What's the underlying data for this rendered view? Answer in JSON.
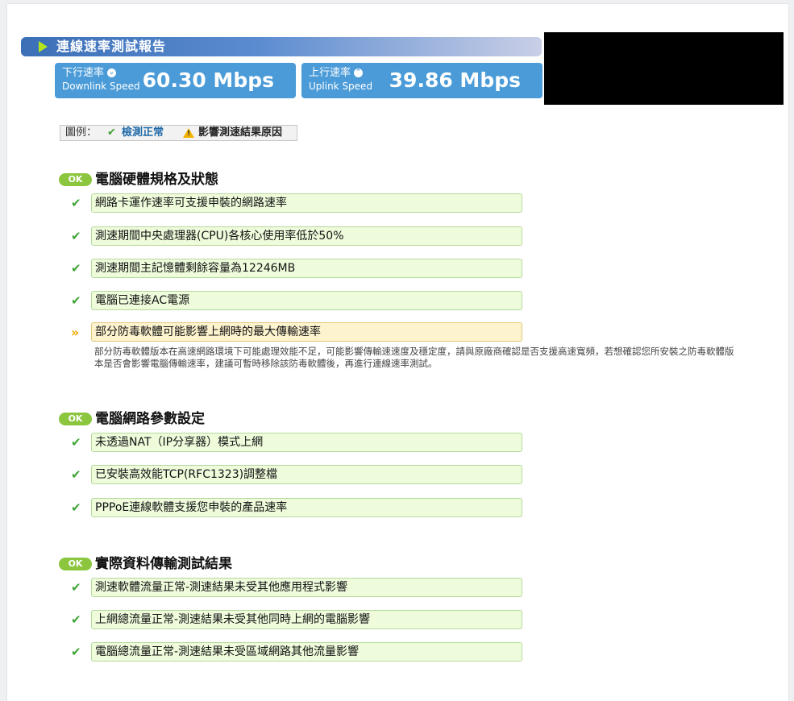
{
  "report": {
    "title": "連線速率測試報告",
    "downlink": {
      "label_zh": "下行速率",
      "label_en": "Downlink Speed",
      "value": "60.30 Mbps"
    },
    "uplink": {
      "label_zh": "上行速率",
      "label_en": "Uplink Speed",
      "value": "39.86 Mbps"
    }
  },
  "legend": {
    "label": "圖例：",
    "normal": "檢測正常",
    "warning": "影響測速結果原因"
  },
  "sections": [
    {
      "badge": "OK",
      "title": "電腦硬體規格及狀態",
      "items": [
        {
          "text": "網路卡運作速率可支援申裝的網路速率",
          "status": "ok"
        },
        {
          "text": "測速期間中央處理器(CPU)各核心使用率低於50%",
          "status": "ok"
        },
        {
          "text": "測速期間主記憶體剩餘容量為12246MB",
          "status": "ok"
        },
        {
          "text": "電腦已連接AC電源",
          "status": "ok"
        },
        {
          "text": "部分防毒軟體可能影響上網時的最大傳輸速率",
          "status": "warning",
          "description": "部分防毒軟體版本在高速網路環境下可能處理效能不足，可能影響傳輸速速度及穩定度，請與原廠商確認是否支援高速寬頻，若想確認您所安裝之防毒軟體版本是否會影響電腦傳輸速率，建議可暫時移除該防毒軟體後，再進行連線速率測試。"
        }
      ]
    },
    {
      "badge": "OK",
      "title": "電腦網路參數設定",
      "items": [
        {
          "text": "未透過NAT（IP分享器）模式上網",
          "status": "ok"
        },
        {
          "text": "已安裝高效能TCP(RFC1323)調整檔",
          "status": "ok"
        },
        {
          "text": "PPPoE連線軟體支援您申裝的產品速率",
          "status": "ok"
        }
      ]
    },
    {
      "badge": "OK",
      "title": "實際資料傳輸測試結果",
      "items": [
        {
          "text": "測速軟體流量正常-測速結果未受其他應用程式影響",
          "status": "ok"
        },
        {
          "text": "上網總流量正常-測速結果未受其他同時上網的電腦影響",
          "status": "ok"
        },
        {
          "text": "電腦總流量正常-測速結果未受區域網路其他流量影響",
          "status": "ok"
        }
      ]
    }
  ],
  "icons": {
    "ok": "check-icon",
    "warning": "double-chevron-icon",
    "downlink": "down-arrow-circle-icon",
    "uplink": "up-arrow-circle-icon"
  },
  "colors": {
    "title_bar": "#4a7fc4",
    "speed_box": "#4a9bd8",
    "ok_badge": "#8cc63f",
    "ok_item_bg": "#eefcdc",
    "warn_item_bg": "#fdf3cf",
    "check": "#3fa437",
    "warning": "#f2a900"
  }
}
